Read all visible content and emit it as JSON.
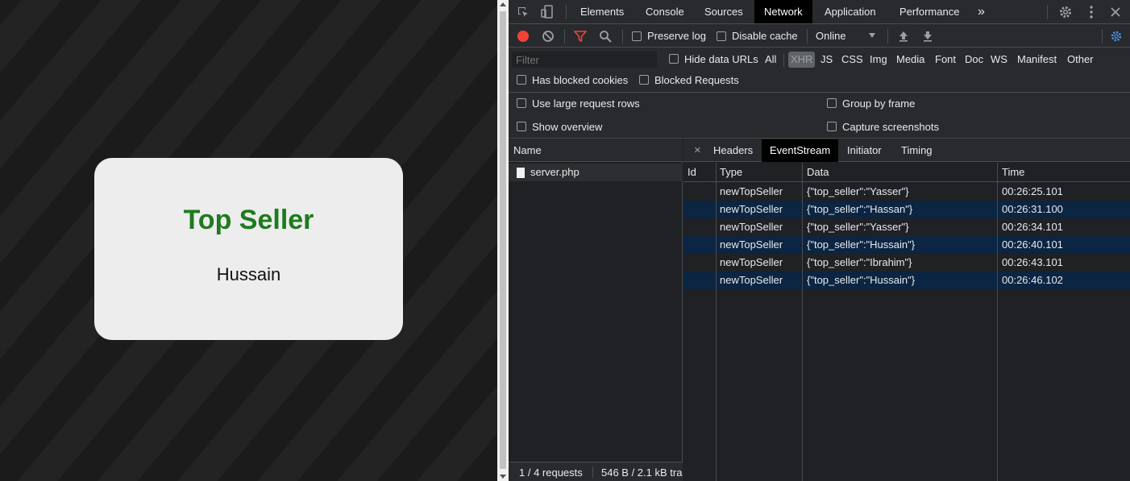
{
  "page": {
    "card_title": "Top Seller",
    "top_seller_name": "Hussain"
  },
  "devtools": {
    "tabs": [
      "Elements",
      "Console",
      "Sources",
      "Network",
      "Application",
      "Performance"
    ],
    "active_tab": "Network",
    "more_tabs_glyph": "»",
    "toolbar": {
      "preserve_log": "Preserve log",
      "disable_cache": "Disable cache",
      "throttling": "Online"
    },
    "filter": {
      "placeholder": "Filter",
      "hide_data_urls": "Hide data URLs",
      "types": [
        "All",
        "XHR",
        "JS",
        "CSS",
        "Img",
        "Media",
        "Font",
        "Doc",
        "WS",
        "Manifest",
        "Other"
      ],
      "selected_type": "XHR",
      "has_blocked_cookies": "Has blocked cookies",
      "blocked_requests": "Blocked Requests"
    },
    "settings": {
      "large_rows": "Use large request rows",
      "show_overview": "Show overview",
      "group_by_frame": "Group by frame",
      "capture_screenshots": "Capture screenshots"
    },
    "requests": {
      "header": "Name",
      "items": [
        "server.php"
      ],
      "status": "1 / 4 requests",
      "transfer": "546 B / 2.1 kB tra"
    },
    "detail": {
      "close_glyph": "×",
      "tabs": [
        "Headers",
        "EventStream",
        "Initiator",
        "Timing"
      ],
      "active_tab": "EventStream",
      "columns": [
        "Id",
        "Type",
        "Data",
        "Time"
      ],
      "events": [
        {
          "id": "",
          "type": "newTopSeller",
          "data": "{\"top_seller\":\"Yasser\"}",
          "time": "00:26:25.101"
        },
        {
          "id": "",
          "type": "newTopSeller",
          "data": "{\"top_seller\":\"Hassan\"}",
          "time": "00:26:31.100"
        },
        {
          "id": "",
          "type": "newTopSeller",
          "data": "{\"top_seller\":\"Yasser\"}",
          "time": "00:26:34.101"
        },
        {
          "id": "",
          "type": "newTopSeller",
          "data": "{\"top_seller\":\"Hussain\"}",
          "time": "00:26:40.101"
        },
        {
          "id": "",
          "type": "newTopSeller",
          "data": "{\"top_seller\":\"Ibrahim\"}",
          "time": "00:26:43.101"
        },
        {
          "id": "",
          "type": "newTopSeller",
          "data": "{\"top_seller\":\"Hussain\"}",
          "time": "00:26:46.102"
        }
      ]
    },
    "colors": {
      "record": "#f44336",
      "filter_active": "#f44336",
      "accent": "#8ab4f8",
      "card_title": "#1e7b1e",
      "selected_row": "#0b2542"
    }
  }
}
